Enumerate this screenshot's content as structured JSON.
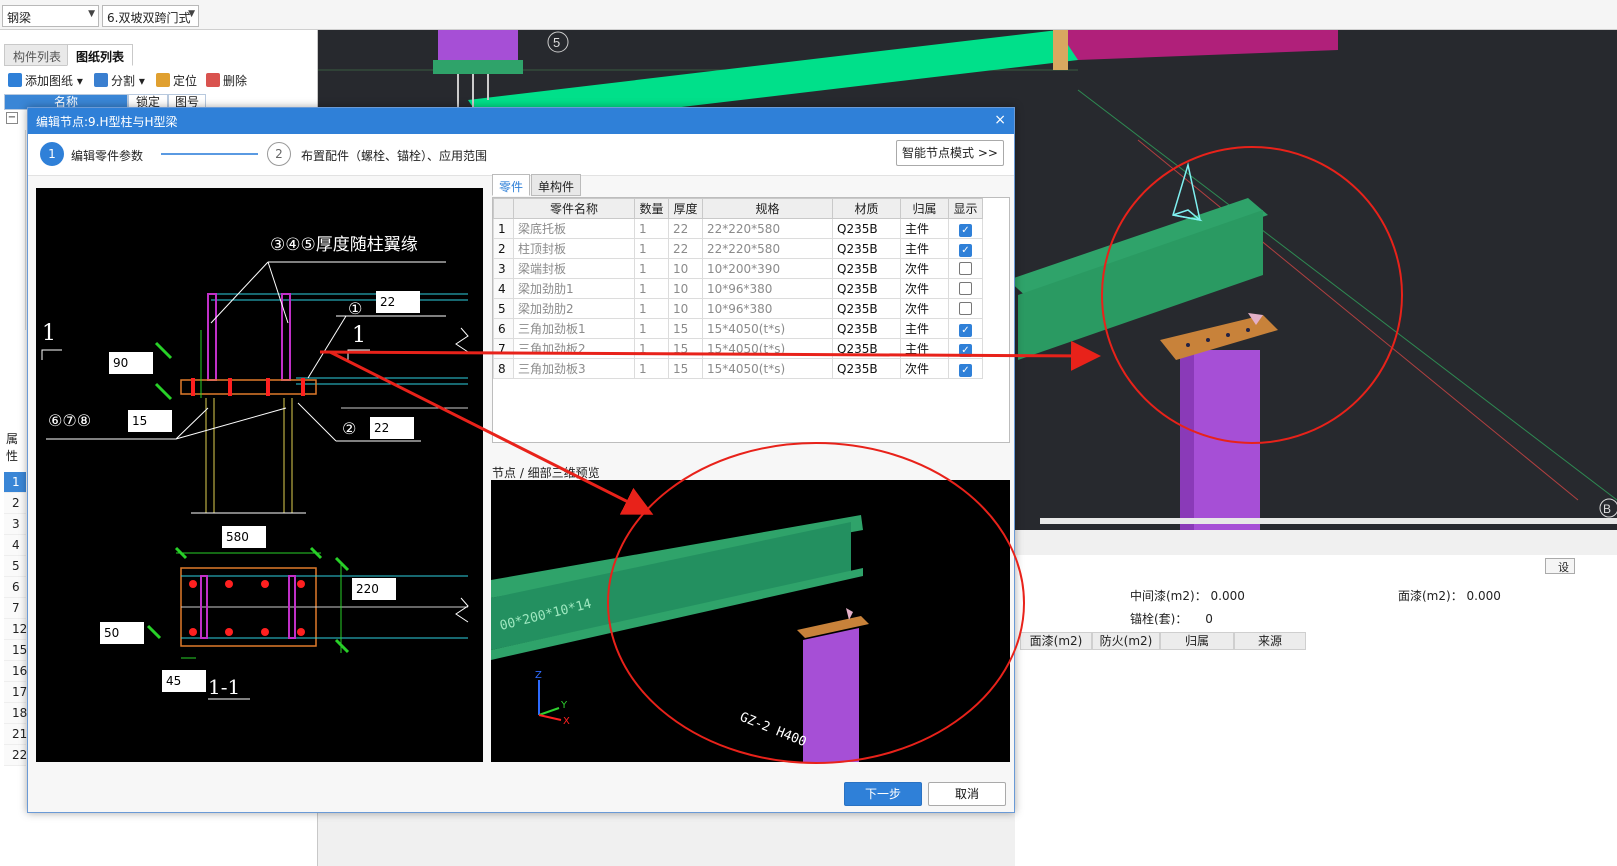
{
  "topbar": {
    "category_value": "钢梁",
    "template_value": "6.双坡双跨门式"
  },
  "left_panel": {
    "tabs": [
      "构件列表",
      "图纸列表"
    ],
    "tools": {
      "add_drawing": "添加图纸",
      "split": "分割",
      "locate": "定位",
      "delete": "删除"
    },
    "columns": {
      "name": "名称",
      "lock": "锁定",
      "number": "图号"
    },
    "attr_tab": "属性",
    "row_numbers": [
      "1",
      "2",
      "3",
      "4",
      "5",
      "6",
      "7",
      "12",
      "15",
      "16",
      "17",
      "18",
      "21",
      "22"
    ]
  },
  "viewport": {
    "axis_label_5": "5",
    "axis_label_b": "B"
  },
  "lower_panel": {
    "mid_paint_label": "中间漆(m2)：",
    "mid_paint_value": "0.000",
    "top_paint_label": "面漆(m2)：",
    "top_paint_value": "0.000",
    "anchor_label": "锚栓(套)：",
    "anchor_value": "0",
    "headers": [
      "面漆(m2)",
      "防火(m2)",
      "归属",
      "来源"
    ],
    "side_btn": "设"
  },
  "dialog": {
    "title": "编辑节点:9.H型柱与H型梁",
    "close_icon": "×",
    "steps": [
      {
        "num": "1",
        "label": "编辑零件参数"
      },
      {
        "num": "2",
        "label": "布置配件（螺栓、锚栓）、应用范围"
      }
    ],
    "smart_mode_btn": "智能节点模式 >>",
    "drawing": {
      "note_345": "③④⑤厚度随柱翼缘",
      "section_mark": "1",
      "circle_1": "①",
      "circle_2": "②",
      "note_678": "⑥⑦⑧",
      "dim_22a": "22",
      "dim_90": "90",
      "dim_15": "15",
      "dim_22b": "22",
      "dim_580": "580",
      "dim_220": "220",
      "dim_50": "50",
      "dim_45": "45",
      "section_title": "1-1"
    },
    "part_tabs": [
      "零件",
      "单构件"
    ],
    "table": {
      "headers": [
        "零件名称",
        "数量",
        "厚度",
        "规格",
        "材质",
        "归属",
        "显示"
      ],
      "rows": [
        {
          "idx": "1",
          "name": "梁底托板",
          "qty": "1",
          "thk": "22",
          "spec": "22*220*580",
          "mat": "Q235B",
          "own": "主件",
          "show": true
        },
        {
          "idx": "2",
          "name": "柱顶封板",
          "qty": "1",
          "thk": "22",
          "spec": "22*220*580",
          "mat": "Q235B",
          "own": "主件",
          "show": true
        },
        {
          "idx": "3",
          "name": "梁端封板",
          "qty": "1",
          "thk": "10",
          "spec": "10*200*390",
          "mat": "Q235B",
          "own": "次件",
          "show": false
        },
        {
          "idx": "4",
          "name": "梁加劲肋1",
          "qty": "1",
          "thk": "10",
          "spec": "10*96*380",
          "mat": "Q235B",
          "own": "次件",
          "show": false
        },
        {
          "idx": "5",
          "name": "梁加劲肋2",
          "qty": "1",
          "thk": "10",
          "spec": "10*96*380",
          "mat": "Q235B",
          "own": "次件",
          "show": false
        },
        {
          "idx": "6",
          "name": "三角加劲板1",
          "qty": "1",
          "thk": "15",
          "spec": "15*4050(t*s)",
          "mat": "Q235B",
          "own": "主件",
          "show": true
        },
        {
          "idx": "7",
          "name": "三角加劲板2",
          "qty": "1",
          "thk": "15",
          "spec": "15*4050(t*s)",
          "mat": "Q235B",
          "own": "主件",
          "show": true
        },
        {
          "idx": "8",
          "name": "三角加劲板3",
          "qty": "1",
          "thk": "15",
          "spec": "15*4050(t*s)",
          "mat": "Q235B",
          "own": "次件",
          "show": true
        }
      ]
    },
    "preview_label": "节点 / 细部三维预览",
    "preview_text_1": "00*200*10*14",
    "preview_text_2": "GZ-2 H400",
    "next_btn": "下一步",
    "cancel_btn": "取消"
  },
  "colors": {
    "title_blue": "#2f80d8",
    "beam_green": "#2fa36a",
    "column_purple": "#a64fd6",
    "plate_orange": "#c8823a",
    "annotation_red": "#e8221a"
  }
}
